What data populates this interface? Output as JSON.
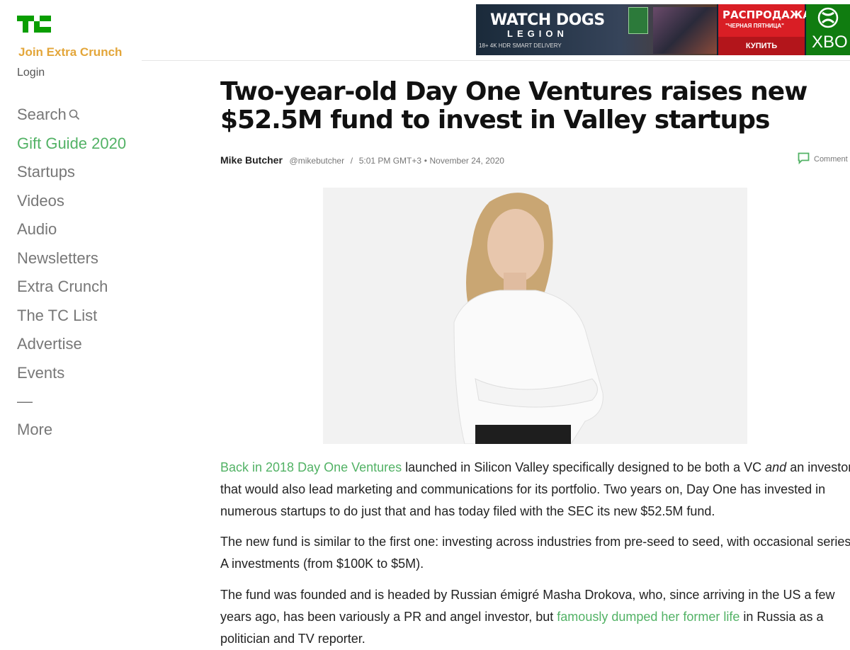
{
  "sidebar": {
    "logo_alt": "TC",
    "join_label": "Join Extra Crunch",
    "login_label": "Login",
    "nav": [
      {
        "label": "Search",
        "icon": "search-icon"
      },
      {
        "label": "Gift Guide 2020"
      },
      {
        "label": "Startups"
      },
      {
        "label": "Videos"
      },
      {
        "label": "Audio"
      },
      {
        "label": "Newsletters"
      },
      {
        "label": "Extra Crunch"
      },
      {
        "label": "The TC List"
      },
      {
        "label": "Advertise"
      },
      {
        "label": "Events"
      },
      {
        "label": "—"
      },
      {
        "label": "More"
      }
    ]
  },
  "ad": {
    "title": "WATCH DOGS",
    "subtitle": "LEGION",
    "tags": "18+  4K  HDR  SMART DELIVERY",
    "sale": "РАСПРОДАЖА",
    "sale_sub": "\"ЧЕРНАЯ ПЯТНИЦА\"",
    "buy": "КУПИТЬ",
    "xbox": "XBO"
  },
  "article": {
    "headline": "Two-year-old Day One Ventures raises new $52.5M fund to invest in Valley startups",
    "author": "Mike Butcher",
    "handle": "@mikebutcher",
    "separator": "/",
    "time": "5:01 PM GMT+3",
    "dot": "•",
    "date": "November 24, 2020",
    "comment_label": "Comment",
    "p1_link": "Back in 2018 Day One Ventures",
    "p1_a": " launched in Silicon Valley specifically designed to be both a VC ",
    "p1_em": "and",
    "p1_b": " an investor that would also lead marketing and communications for its portfolio. Two years on, Day One has invested in numerous startups to do just that and has today filed with the SEC its new $52.5M fund.",
    "p2": "The new fund is similar to the first one: investing across industries from pre-seed to seed, with occasional series A investments (from $100K to $5M).",
    "p3_a": "The fund was founded and is headed by Russian émigré Masha Drokova, who, since arriving in the US a few years ago, has been variously a PR and angel investor, but ",
    "p3_link": "famously dumped her former life",
    "p3_b": " in Russia as a politician and TV reporter."
  },
  "colors": {
    "brand_green": "#52b265",
    "extra_crunch_gold": "#e3a63a",
    "nav_gray": "#777777"
  }
}
